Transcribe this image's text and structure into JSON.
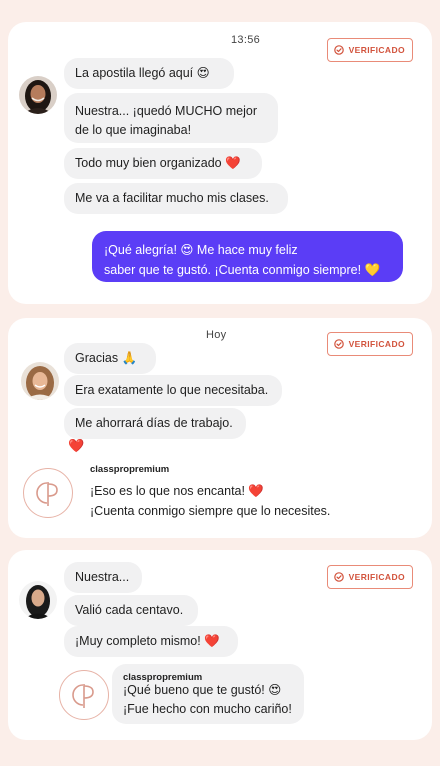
{
  "verified_label": "VERIFICADO",
  "card1": {
    "time": "13:56",
    "messages": [
      "La apostila llegó aquí 😍",
      "Nuestra... ¡quedó MUCHO mejor",
      "de lo que imaginaba!",
      "Todo muy bien organizado ❤️",
      "Me va a facilitar mucho mis clases."
    ],
    "reply": [
      "¡Qué alegría! 😍  Me hace muy feliz",
      "saber que te gustó. ¡Cuenta conmigo siempre! 💛"
    ]
  },
  "card2": {
    "time": "Hoy",
    "messages": [
      "Gracias 🙏",
      "Era exatamente lo que necesitaba.",
      "Me ahorrará días de trabajo.",
      "❤️"
    ],
    "reply_author": "classpropremium",
    "reply": [
      "¡Eso es lo que nos encanta!  ❤️",
      "¡Cuenta conmigo siempre que lo necesites."
    ]
  },
  "card3": {
    "messages": [
      "Nuestra...",
      "Valió cada centavo.",
      "¡Muy completo mismo! ❤️"
    ],
    "reply_author": "classpropremium",
    "reply": [
      "¡Qué bueno que te gustó! 😍",
      "¡Fue hecho con mucho cariño!"
    ]
  },
  "colors": {
    "accent": "#5b3df6",
    "badge": "#d2533c",
    "background": "#fbeee9"
  },
  "icons": [
    "check-circle-icon",
    "avatar-photo",
    "classpro-logo"
  ]
}
